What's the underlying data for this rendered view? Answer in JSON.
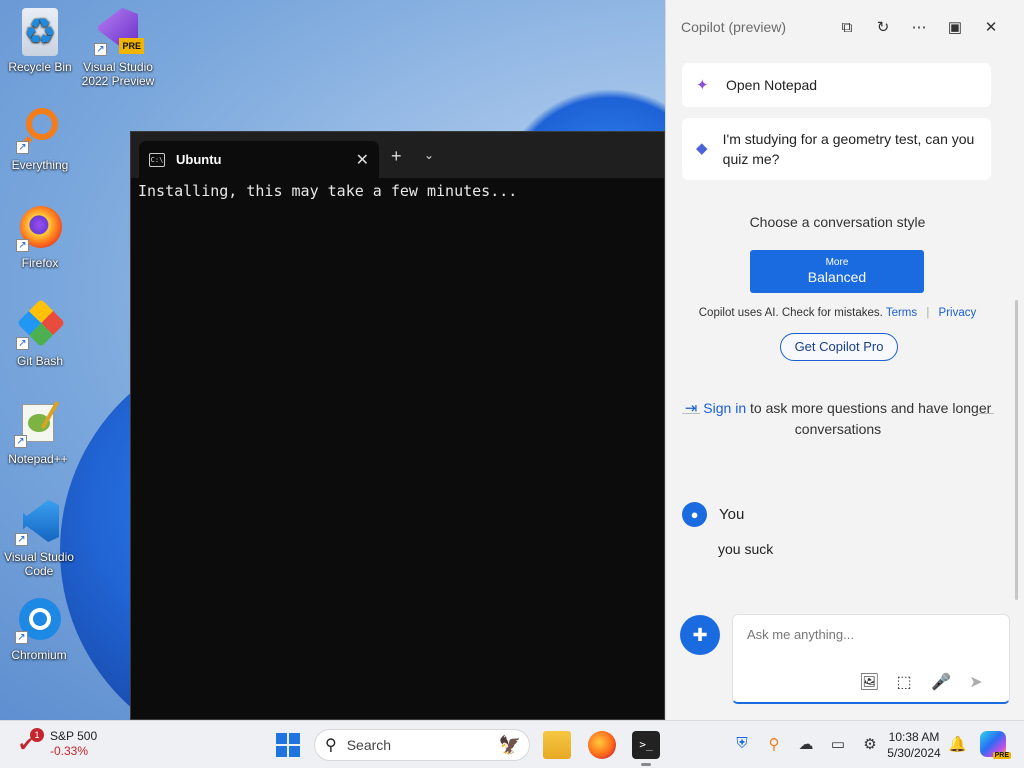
{
  "desktop": {
    "icons": [
      {
        "label": "Recycle Bin",
        "glyph": "♻",
        "name": "recycle-bin-icon",
        "color": "#1e8be0"
      },
      {
        "label": "Visual Studio 2022 Preview",
        "glyph": "◆",
        "name": "visual-studio-icon",
        "color": "#8a55d6",
        "badge": "PRE"
      },
      {
        "label": "Everything",
        "glyph": "⚲",
        "name": "everything-search-icon",
        "color": "#f27d1a"
      },
      {
        "label": "Firefox",
        "glyph": "●",
        "name": "firefox-icon",
        "color": "#ff6a1a"
      },
      {
        "label": "Git Bash",
        "glyph": "◈",
        "name": "git-bash-icon",
        "color": "#4caf50"
      },
      {
        "label": "Notepad++",
        "glyph": "✎",
        "name": "notepad-plus-plus-icon",
        "color": "#7cb342"
      },
      {
        "label": "Visual Studio Code",
        "glyph": "⟩",
        "name": "vscode-icon",
        "color": "#1e88e5"
      },
      {
        "label": "Chromium",
        "glyph": "◉",
        "name": "chromium-icon",
        "color": "#1e88e5"
      }
    ]
  },
  "terminal": {
    "tab_title": "Ubuntu",
    "tab_icon_text": "C:\\",
    "close_glyph": "✕",
    "new_tab_glyph": "+",
    "dropdown_glyph": "⌄",
    "output": "Installing, this may take a few minutes..."
  },
  "copilot": {
    "title": "Copilot (preview)",
    "header_buttons": [
      {
        "name": "open-external-icon",
        "glyph": "⧉"
      },
      {
        "name": "refresh-icon",
        "glyph": "↻"
      },
      {
        "name": "more-options-icon",
        "glyph": "⋯"
      },
      {
        "name": "dock-sidebar-icon",
        "glyph": "▣"
      },
      {
        "name": "close-icon",
        "glyph": "✕"
      }
    ],
    "suggestions": [
      {
        "text": "Open Notepad",
        "glyph": "✦",
        "color": "#8a4fe0"
      },
      {
        "text": "I'm studying for a geometry test, can you quiz me?",
        "glyph": "💬",
        "color": "#4a63d8"
      }
    ],
    "style_label": "Choose a conversation style",
    "style_button": {
      "small": "More",
      "big": "Balanced"
    },
    "disclaimer": "Copilot uses AI. Check for mistakes.",
    "terms_label": "Terms",
    "privacy_label": "Privacy",
    "pro_button": "Get Copilot Pro",
    "signin_link": "Sign in",
    "signin_rest": "to ask more questions and have longer conversations",
    "user_name": "You",
    "user_message": "you suck",
    "input_placeholder": "Ask me anything...",
    "input_icons": [
      {
        "name": "add-image-icon",
        "glyph": "🖼"
      },
      {
        "name": "screenshot-icon",
        "glyph": "⬚"
      },
      {
        "name": "microphone-icon",
        "glyph": "🎤"
      },
      {
        "name": "send-icon",
        "glyph": "➤"
      }
    ]
  },
  "taskbar": {
    "stock_name": "S&P 500",
    "stock_change": "-0.33%",
    "stock_badge": "1",
    "search_label": "Search",
    "time": "10:38 AM",
    "date": "5/30/2024",
    "tray_icons": [
      {
        "name": "security-shield-icon",
        "glyph": "⛨"
      },
      {
        "name": "everything-tray-icon",
        "glyph": "⚲"
      },
      {
        "name": "onedrive-icon",
        "glyph": "☁"
      },
      {
        "name": "display-icon",
        "glyph": "▭"
      },
      {
        "name": "network-icon",
        "glyph": "⚙"
      }
    ],
    "copilot_badge": "PRE"
  }
}
